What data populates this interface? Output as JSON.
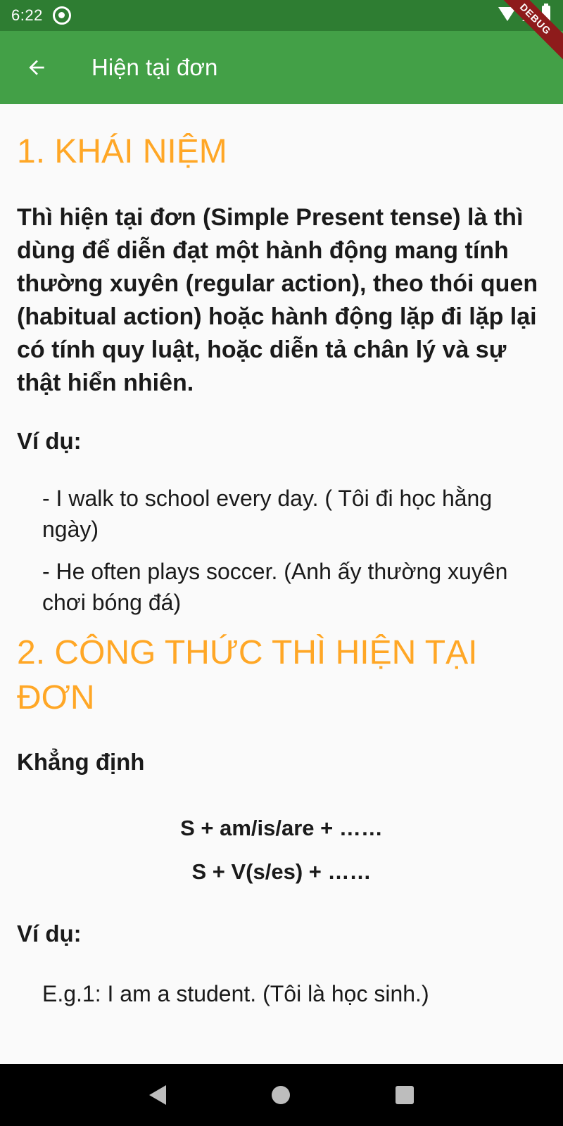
{
  "status_bar": {
    "time": "6:22",
    "icons": [
      "notification-icon",
      "wifi-icon",
      "signal-icon",
      "battery-icon"
    ]
  },
  "app_bar": {
    "title": "Hiện tại đơn",
    "back_icon": "arrow-back-icon",
    "background": "#43a047"
  },
  "debug_banner": "DEBUG",
  "colors": {
    "accent": "#ffa726",
    "status_bar": "#2e7d32",
    "app_bar": "#43a047"
  },
  "content": {
    "section1_title": "1. KHÁI NIỆM",
    "definition": "Thì hiện tại đơn (Simple Present tense) là thì dùng để diễn đạt một hành động mang tính thường xuyên (regular action), theo thói quen (habitual action) hoặc hành động lặp đi lặp lại có tính quy luật, hoặc diễn tả chân lý và sự thật hiển nhiên.",
    "example_label": "Ví dụ:",
    "examples": [
      "- I walk to school every day. ( Tôi đi học hằng ngày)",
      "- He often plays soccer. (Anh ấy thường xuyên chơi bóng đá)"
    ],
    "section2_title": "2. CÔNG THỨC THÌ HIỆN TẠI ĐƠN",
    "affirmative_label": "Khẳng định",
    "formulas": [
      "S + am/is/are + ……",
      "S + V(s/es) + ……"
    ],
    "example_label_2": "Ví dụ:",
    "eg1": "E.g.1:  I am a student. (Tôi là học sinh.)"
  },
  "nav_bar": {
    "icons": [
      "back-triangle-icon",
      "home-circle-icon",
      "recents-square-icon"
    ]
  }
}
